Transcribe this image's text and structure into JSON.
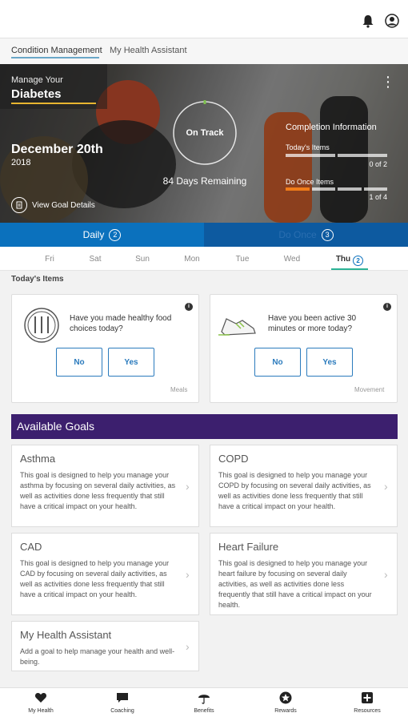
{
  "header": {
    "icons": [
      "bell-icon",
      "user-account-icon"
    ]
  },
  "subnav": {
    "tab1": "Condition Management",
    "tab2": "My Health Assistant"
  },
  "hero": {
    "manage_label": "Manage Your",
    "condition": "Diabetes",
    "date": "December 20th",
    "year": "2018",
    "view_goal": "View Goal Details",
    "status": "On Track",
    "remaining": "84 Days Remaining",
    "completion_title": "Completion Information",
    "todays_items_label": "Today's Items",
    "todays_items_count": "0 of 2",
    "todays_items_done": 0,
    "todays_items_total": 2,
    "do_once_label": "Do Once Items",
    "do_once_count": "1 of 4",
    "do_once_done": 1,
    "do_once_total": 4,
    "accent": "#f07c1a"
  },
  "tabs": {
    "daily": "Daily",
    "daily_count": "2",
    "once": "Do Once",
    "once_count": "3"
  },
  "days": [
    {
      "label": "Fri"
    },
    {
      "label": "Sat"
    },
    {
      "label": "Sun"
    },
    {
      "label": "Mon"
    },
    {
      "label": "Tue"
    },
    {
      "label": "Wed"
    },
    {
      "label": "Thu",
      "badge": "2"
    }
  ],
  "today_label": "Today's Items",
  "cards": [
    {
      "question": "Have you made healthy food choices today?",
      "no": "No",
      "yes": "Yes",
      "category": "Meals"
    },
    {
      "question": "Have you been active 30 minutes or more today?",
      "no": "No",
      "yes": "Yes",
      "category": "Movement"
    }
  ],
  "available_goals": {
    "title": "Available Goals",
    "items": [
      {
        "title": "Asthma",
        "desc": "This goal is designed to help you manage your asthma by focusing on several daily activities, as well as activities done less frequently that still have a critical impact on your health."
      },
      {
        "title": "COPD",
        "desc": "This goal is designed to help you manage your COPD by focusing on several daily activities, as well as activities done less frequently that still have a critical impact on your health."
      },
      {
        "title": "CAD",
        "desc": "This goal is designed to help you manage your CAD by focusing on several daily activities, as well as activities done less frequently that still have a critical impact on your health."
      },
      {
        "title": "Heart Failure",
        "desc": "This goal is designed to help you manage your heart failure by focusing on several daily activities, as well as activities done less frequently that still have a critical impact on your health."
      },
      {
        "title": "My Health Assistant",
        "desc": "Add a goal to help manage your health and well-being."
      }
    ]
  },
  "bottom_nav": [
    {
      "label": "My Health",
      "icon": "heart-icon"
    },
    {
      "label": "Coaching",
      "icon": "chat-icon"
    },
    {
      "label": "Benefits",
      "icon": "umbrella-icon"
    },
    {
      "label": "Rewards",
      "icon": "star-badge-icon"
    },
    {
      "label": "Resources",
      "icon": "plus-box-icon"
    }
  ]
}
